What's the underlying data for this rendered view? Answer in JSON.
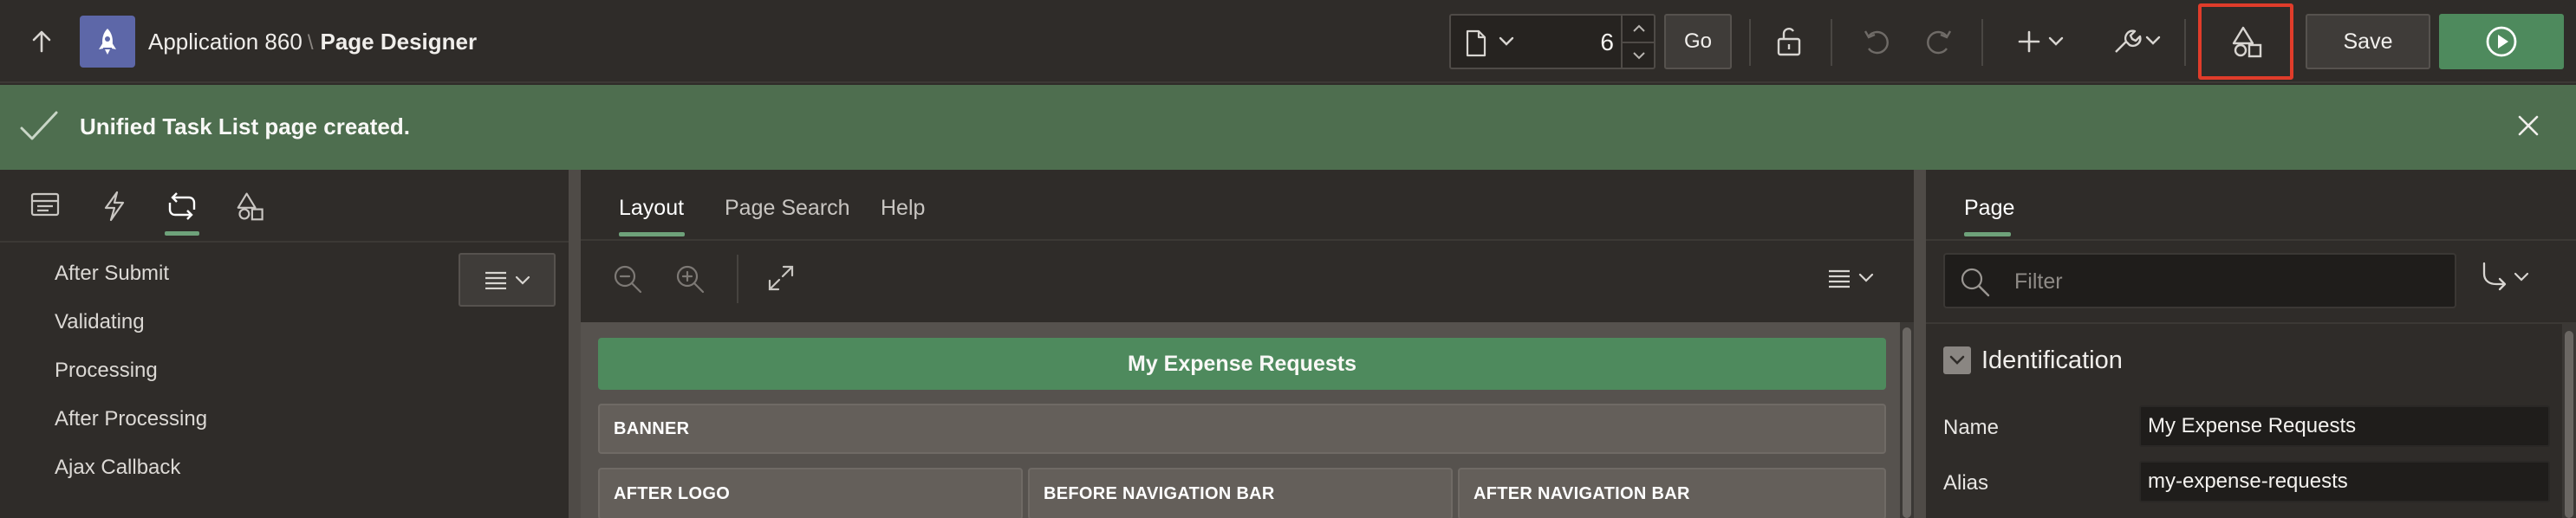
{
  "header": {
    "app_name": "Application 860",
    "separator": "\\",
    "page_name": "Page Designer",
    "page_number": "6",
    "go_label": "Go",
    "save_label": "Save"
  },
  "notification": {
    "message": "Unified Task List page created."
  },
  "left_pane": {
    "tabs": [
      "rendering",
      "dynamic-actions",
      "processing",
      "shared-components"
    ],
    "active_tab": "processing",
    "tree_items": [
      "After Submit",
      "Validating",
      "Processing",
      "After Processing",
      "Ajax Callback"
    ]
  },
  "center_pane": {
    "tabs": [
      {
        "label": "Layout",
        "active": true
      },
      {
        "label": "Page Search",
        "active": false
      },
      {
        "label": "Help",
        "active": false
      }
    ],
    "region_title": "My Expense Requests",
    "slots": {
      "banner": "BANNER",
      "after_logo": "AFTER LOGO",
      "before_nav_bar": "BEFORE NAVIGATION BAR",
      "after_nav_bar": "AFTER NAVIGATION BAR"
    }
  },
  "right_pane": {
    "tab": "Page",
    "filter_placeholder": "Filter",
    "group_title": "Identification",
    "properties": [
      {
        "label": "Name",
        "value": "My Expense Requests"
      },
      {
        "label": "Alias",
        "value": "my-expense-requests"
      }
    ]
  },
  "colors": {
    "accent_green": "#4e8a5d",
    "banner_green": "#4e6e4f",
    "app_tile": "#5d67a8",
    "highlight_red": "#e03c2a"
  }
}
